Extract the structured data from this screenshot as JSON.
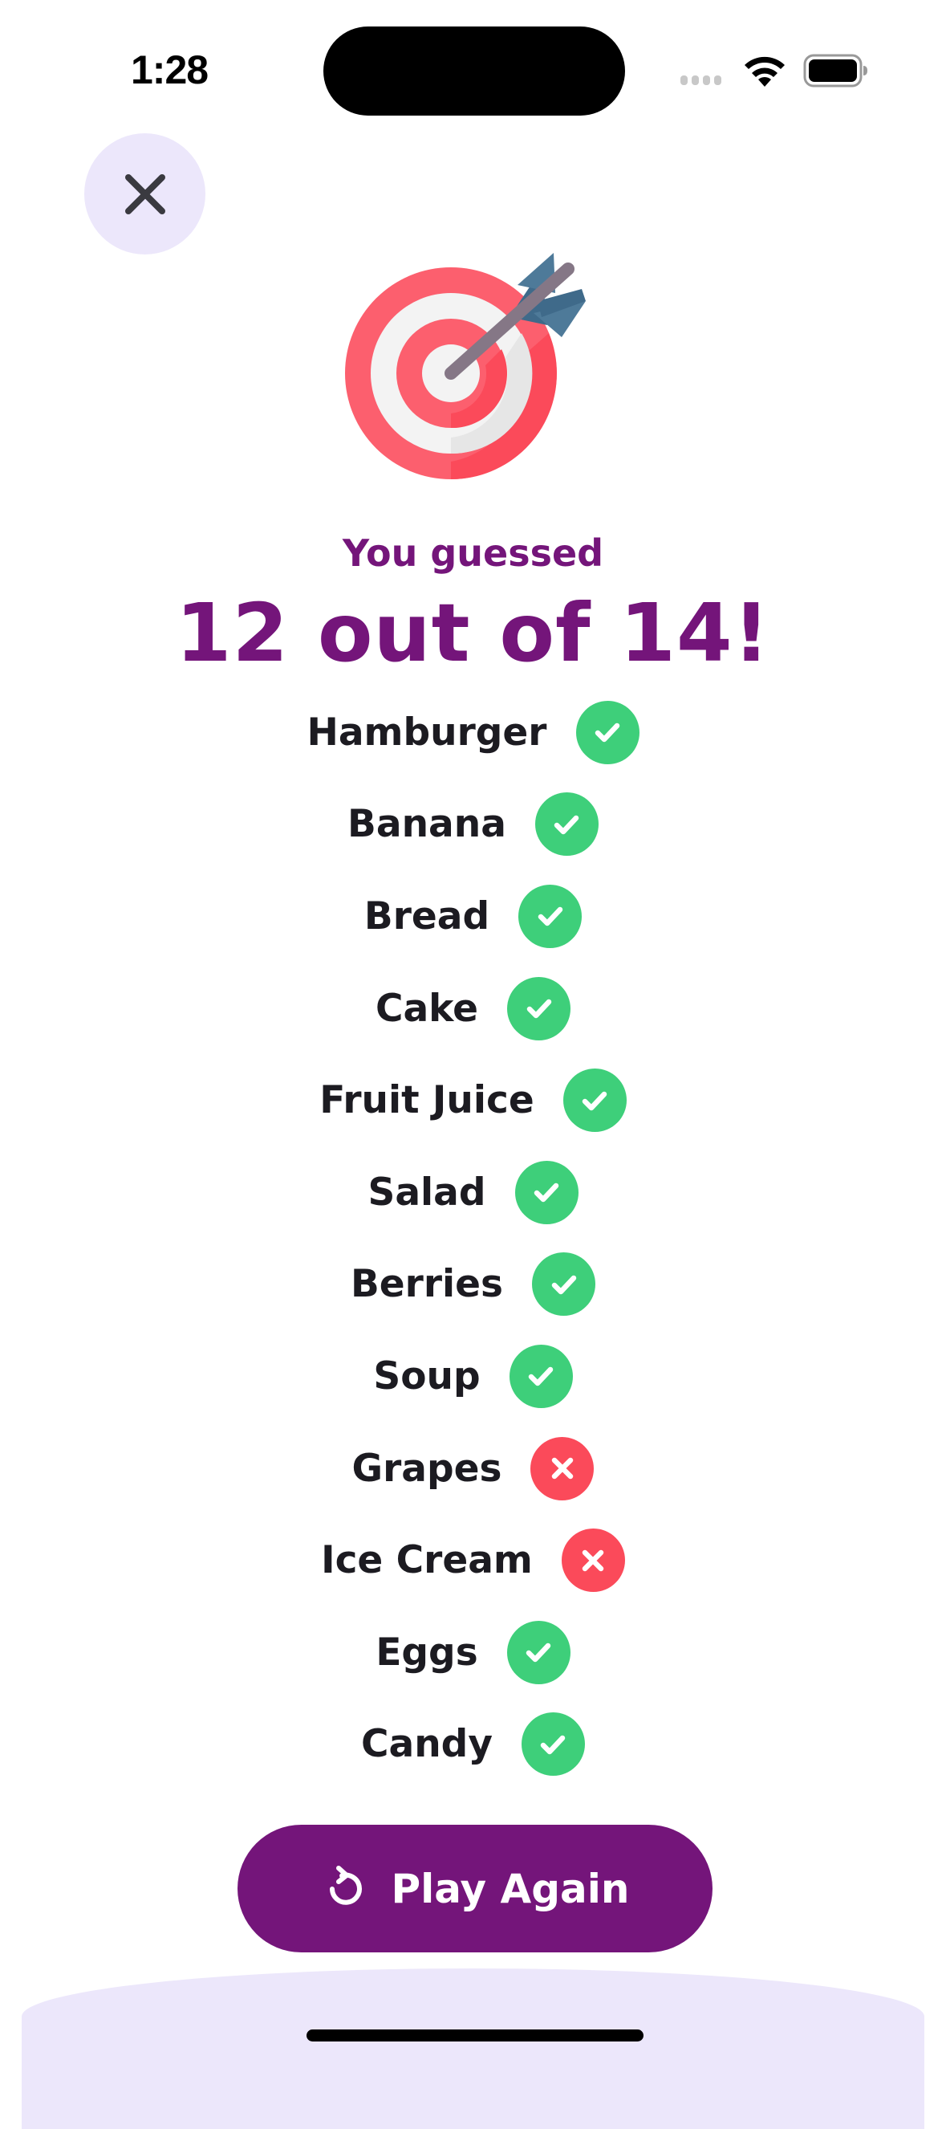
{
  "status_bar": {
    "time": "1:28",
    "icons": [
      "cellular-signal-icon",
      "wifi-icon",
      "battery-icon"
    ]
  },
  "header": {
    "close_icon": "close-icon",
    "hero_icon": "bullseye-target-with-arrow-icon"
  },
  "result": {
    "subtitle": "You guessed",
    "score_text": "12 out of 14!",
    "correct_count": 12,
    "total_count": 14
  },
  "items": [
    {
      "label": "Hamburger",
      "status": "correct",
      "icon": "check-icon"
    },
    {
      "label": "Banana",
      "status": "correct",
      "icon": "check-icon"
    },
    {
      "label": "Bread",
      "status": "correct",
      "icon": "check-icon"
    },
    {
      "label": "Cake",
      "status": "correct",
      "icon": "check-icon"
    },
    {
      "label": "Fruit Juice",
      "status": "correct",
      "icon": "check-icon"
    },
    {
      "label": "Salad",
      "status": "correct",
      "icon": "check-icon"
    },
    {
      "label": "Berries",
      "status": "correct",
      "icon": "check-icon"
    },
    {
      "label": "Soup",
      "status": "correct",
      "icon": "check-icon"
    },
    {
      "label": "Grapes",
      "status": "wrong",
      "icon": "x-icon"
    },
    {
      "label": "Ice Cream",
      "status": "wrong",
      "icon": "x-icon"
    },
    {
      "label": "Eggs",
      "status": "correct",
      "icon": "check-icon"
    },
    {
      "label": "Candy",
      "status": "correct",
      "icon": "check-icon"
    }
  ],
  "actions": {
    "play_again_label": "Play Again",
    "play_again_icon": "restart-icon"
  },
  "colors": {
    "brand_purple": "#74157A",
    "lavender": "#ECE7FB",
    "correct_green": "#3ECF7A",
    "wrong_red": "#FB4A5A",
    "text_dark": "#1C1B21"
  }
}
